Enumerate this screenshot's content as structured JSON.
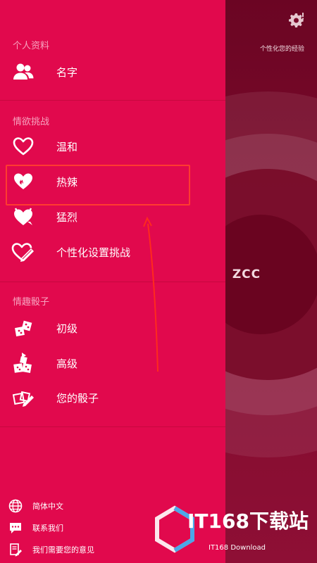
{
  "main": {
    "experience_label": "个性化您的经验",
    "user_initials": "ZCC"
  },
  "drawer": {
    "profile": {
      "title": "个人资料",
      "items": [
        {
          "label": "名字",
          "icon": "people-icon"
        }
      ]
    },
    "challenges": {
      "title": "情欲挑战",
      "items": [
        {
          "label": "温和",
          "icon": "heart-outline-icon"
        },
        {
          "label": "热辣",
          "icon": "heart-flame-icon"
        },
        {
          "label": "猛烈",
          "icon": "heart-devil-icon"
        },
        {
          "label": "个性化设置挑战",
          "icon": "heart-pencil-icon"
        }
      ]
    },
    "dice": {
      "title": "情趣骰子",
      "items": [
        {
          "label": "初级",
          "icon": "dice-basic-icon"
        },
        {
          "label": "高级",
          "icon": "dice-advanced-icon"
        },
        {
          "label": "您的骰子",
          "icon": "dice-custom-icon"
        }
      ]
    },
    "footer": [
      {
        "label": "简体中文",
        "icon": "globe-icon"
      },
      {
        "label": "联系我们",
        "icon": "chat-icon"
      },
      {
        "label": "我们需要您的意见",
        "icon": "feedback-icon"
      }
    ]
  },
  "watermark": {
    "main": "IT168下载站",
    "sub": "IT168 Download"
  },
  "colors": {
    "drawer_bg": "#e1094d",
    "section_title": "#f7a3bf",
    "highlight": "#ff3b30",
    "main_bg": "#7a0a2a"
  }
}
